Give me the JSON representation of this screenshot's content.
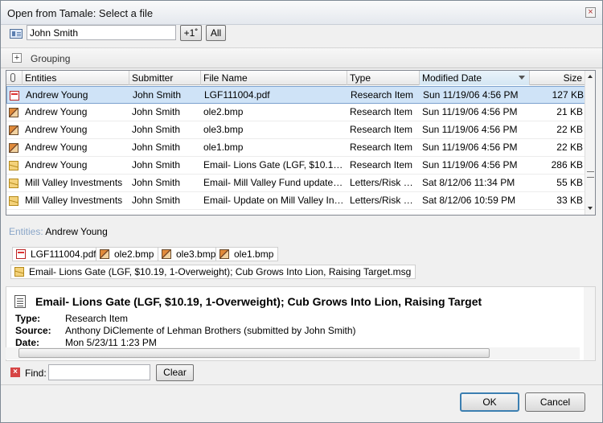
{
  "window": {
    "title": "Open from Tamale: Select a file"
  },
  "toolbar": {
    "entity_value": "John Smith",
    "btn_plus": "+1˚",
    "btn_all": "All"
  },
  "grouping": {
    "label": "Grouping"
  },
  "grid": {
    "headers": [
      "Entities",
      "Submitter",
      "File Name",
      "Type",
      "Modified Date",
      "Size"
    ],
    "rows": [
      {
        "icon": "pdf-icon",
        "entity": "Andrew Young",
        "submitter": "John Smith",
        "file": "LGF111004.pdf",
        "type": "Research Item",
        "date": "Sun 11/19/06 4:56 PM",
        "size": "127 KB"
      },
      {
        "icon": "bmp-icon",
        "entity": "Andrew Young",
        "submitter": "John Smith",
        "file": "ole2.bmp",
        "type": "Research Item",
        "date": "Sun 11/19/06 4:56 PM",
        "size": "21 KB"
      },
      {
        "icon": "bmp-icon",
        "entity": "Andrew Young",
        "submitter": "John Smith",
        "file": "ole3.bmp",
        "type": "Research Item",
        "date": "Sun 11/19/06 4:56 PM",
        "size": "22 KB"
      },
      {
        "icon": "bmp-icon",
        "entity": "Andrew Young",
        "submitter": "John Smith",
        "file": "ole1.bmp",
        "type": "Research Item",
        "date": "Sun 11/19/06 4:56 PM",
        "size": "22 KB"
      },
      {
        "icon": "msg-icon",
        "entity": "Andrew Young",
        "submitter": "John Smith",
        "file": "Email- Lions Gate (LGF, $10.19, 1-Overweight); Cub Grows Into Lion, Raising Target.msg",
        "type": "Research Item",
        "date": "Sun 11/19/06 4:56 PM",
        "size": "286 KB"
      },
      {
        "icon": "msg-icon",
        "entity": "Mill Valley Investments",
        "submitter": "John Smith",
        "file": "Email- Mill Valley Fund update C...",
        "type": "Letters/Risk R...",
        "date": "Sat 8/12/06 11:34 PM",
        "size": "55 KB"
      },
      {
        "icon": "msg-icon",
        "entity": "Mill Valley Investments",
        "submitter": "John Smith",
        "file": "Email- Update on Mill Valley Inve...",
        "type": "Letters/Risk R...",
        "date": "Sat 8/12/06 10:59 PM",
        "size": "33 KB"
      }
    ]
  },
  "details": {
    "entities_label": "Entities:",
    "entities_value": "Andrew Young",
    "attachments": [
      "LGF111004.pdf",
      "ole2.bmp",
      "ole3.bmp",
      "ole1.bmp",
      "Email- Lions Gate (LGF, $10.19, 1-Overweight); Cub Grows Into Lion, Raising Target.msg"
    ]
  },
  "preview": {
    "title": "Email- Lions Gate (LGF, $10.19, 1-Overweight); Cub Grows Into Lion, Raising Target",
    "type_label": "Type:",
    "type_value": "Research Item",
    "source_label": "Source:",
    "source_value": "Anthony DiClemente of Lehman Brothers (submitted by John Smith)",
    "date_label": "Date:",
    "date_value": "Mon 5/23/11 1:23 PM"
  },
  "find": {
    "label": "Find:",
    "clear_label": "Clear"
  },
  "footer": {
    "ok_label": "OK",
    "cancel_label": "Cancel"
  }
}
